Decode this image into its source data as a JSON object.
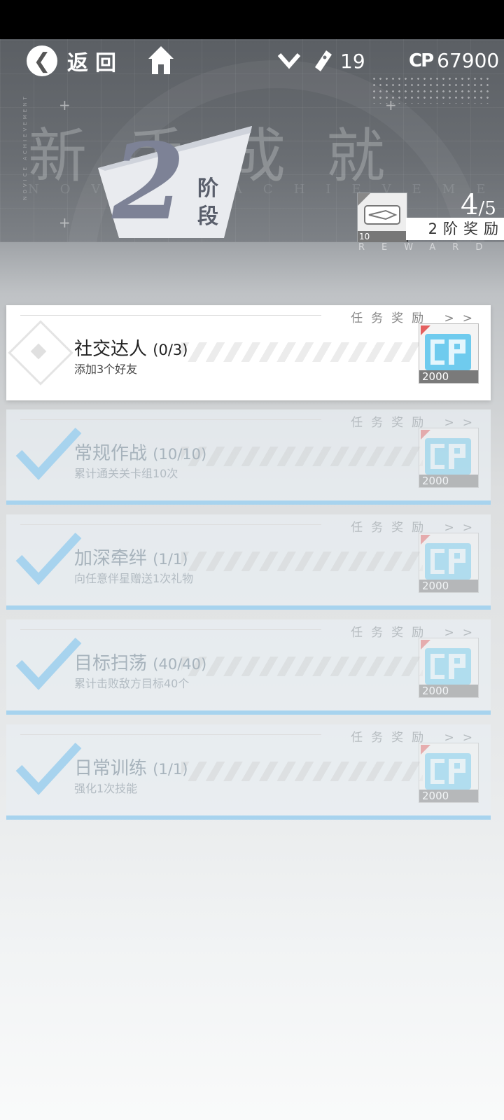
{
  "header": {
    "back_label": "返回",
    "bg_title": "新手成就",
    "bg_subtitle": "NOVICE ACHIEVEMENT",
    "side_caption": "NOVICE ACHIEVEMENT",
    "stage_number": "2",
    "stage_word": "阶段",
    "resources": {
      "tickets": "19",
      "cp_icon_label": "CP",
      "cp": "67900"
    },
    "stage_reward": {
      "item_count": "10",
      "progress_current": "4",
      "progress_total": "/5",
      "label": "2阶奖励",
      "subtitle": "REWARD"
    }
  },
  "tasks": [
    {
      "title": "社交达人",
      "count": "(0/3)",
      "desc": "添加3个好友",
      "reward_label": "任务奖励 >>",
      "reward_amount": "2000",
      "status": "in-progress"
    },
    {
      "title": "常规作战",
      "count": "(10/10)",
      "desc": "累计通关关卡组10次",
      "reward_label": "任务奖励 >>",
      "reward_amount": "2000",
      "status": "completed"
    },
    {
      "title": "加深牵绊",
      "count": "(1/1)",
      "desc": "向任意伴星赠送1次礼物",
      "reward_label": "任务奖励 >>",
      "reward_amount": "2000",
      "status": "completed"
    },
    {
      "title": "目标扫荡",
      "count": "(40/40)",
      "desc": "累计击败敌方目标40个",
      "reward_label": "任务奖励 >>",
      "reward_amount": "2000",
      "status": "completed"
    },
    {
      "title": "日常训练",
      "count": "(1/1)",
      "desc": "强化1次技能",
      "reward_label": "任务奖励 >>",
      "reward_amount": "2000",
      "status": "completed"
    }
  ],
  "colors": {
    "accent_blue": "#a7d3ee",
    "reward_corner": "#e46060"
  }
}
